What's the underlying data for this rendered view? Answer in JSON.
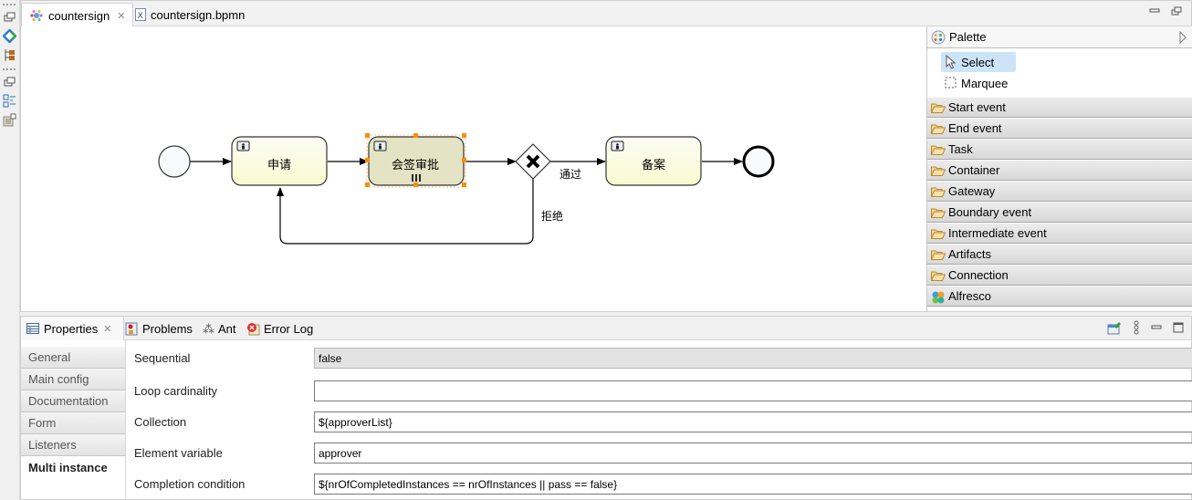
{
  "editor": {
    "tabs": [
      {
        "label": "countersign",
        "icon": "activiti-diagram-icon",
        "active": true,
        "closable": true
      },
      {
        "label": "countersign.bpmn",
        "icon": "xml-file-icon",
        "active": false,
        "closable": false
      }
    ],
    "close_glyph": "✕"
  },
  "diagram": {
    "tasks": [
      {
        "id": "task-apply",
        "label": "申请",
        "selected": false,
        "multi_instance": false
      },
      {
        "id": "task-countersign",
        "label": "会签审批",
        "selected": true,
        "multi_instance": true
      },
      {
        "id": "task-archive",
        "label": "备案",
        "selected": false,
        "multi_instance": false
      }
    ],
    "flows": [
      {
        "label": "通过"
      },
      {
        "label": "拒绝"
      }
    ],
    "colors": {
      "task_fill_top": "#fbfbf6",
      "task_fill_bottom": "#fbfbd0",
      "selected_fill": "#e4e3c3",
      "handle": "#ff8c00"
    }
  },
  "palette": {
    "title": "Palette",
    "tools": [
      {
        "label": "Select",
        "icon": "pointer-icon",
        "selected": true
      },
      {
        "label": "Marquee",
        "icon": "marquee-icon",
        "selected": false
      }
    ],
    "drawers": [
      {
        "label": "Start event",
        "icon": "folder-icon"
      },
      {
        "label": "End event",
        "icon": "folder-icon"
      },
      {
        "label": "Task",
        "icon": "folder-icon"
      },
      {
        "label": "Container",
        "icon": "folder-icon"
      },
      {
        "label": "Gateway",
        "icon": "folder-icon"
      },
      {
        "label": "Boundary event",
        "icon": "folder-icon"
      },
      {
        "label": "Intermediate event",
        "icon": "folder-icon"
      },
      {
        "label": "Artifacts",
        "icon": "folder-icon"
      },
      {
        "label": "Connection",
        "icon": "folder-icon"
      },
      {
        "label": "Alfresco",
        "icon": "alfresco-icon"
      }
    ]
  },
  "bottom": {
    "tabs": [
      {
        "label": "Properties",
        "icon": "properties-icon",
        "active": true
      },
      {
        "label": "Problems",
        "icon": "problems-icon",
        "active": false
      },
      {
        "label": "Ant",
        "icon": "ant-icon",
        "active": false
      },
      {
        "label": "Error Log",
        "icon": "error-log-icon",
        "active": false
      }
    ],
    "property_tabs": [
      {
        "label": "General",
        "active": false
      },
      {
        "label": "Main config",
        "active": false
      },
      {
        "label": "Documentation",
        "active": false
      },
      {
        "label": "Form",
        "active": false
      },
      {
        "label": "Listeners",
        "active": false
      },
      {
        "label": "Multi instance",
        "active": true
      }
    ],
    "fields": [
      {
        "label": "Sequential",
        "value": "false",
        "readonly": true
      },
      {
        "label": "Loop cardinality",
        "value": "",
        "readonly": false
      },
      {
        "label": "Collection",
        "value": "${approverList}",
        "readonly": false
      },
      {
        "label": "Element variable",
        "value": "approver",
        "readonly": false
      },
      {
        "label": "Completion condition",
        "value": "${nrOfCompletedInstances == nrOfInstances || pass == false}",
        "readonly": false
      }
    ]
  }
}
